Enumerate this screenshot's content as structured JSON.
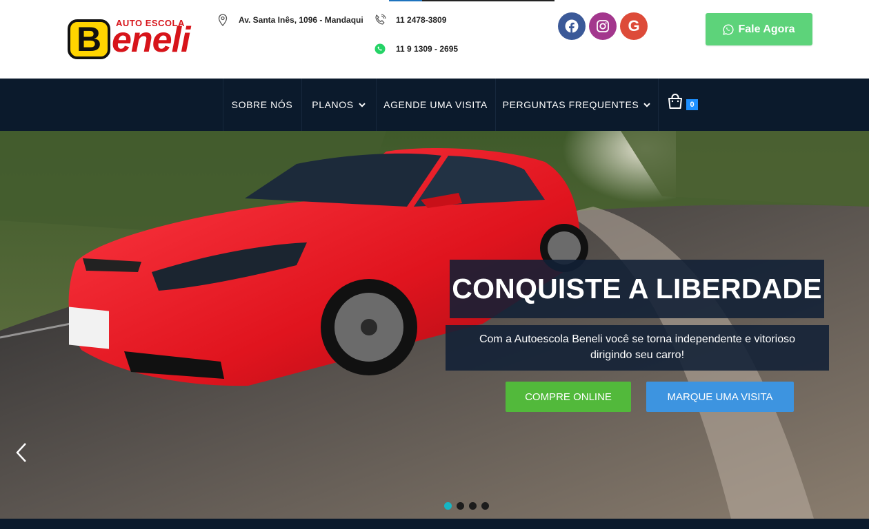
{
  "header": {
    "logo": {
      "top_text": "AUTO ESCOLA",
      "badge_letter": "B",
      "word": "eneli"
    },
    "address": "Av. Santa Inês, 1096 - Mandaqui",
    "phone": "11 2478-3809",
    "whatsapp": "11 9 1309 - 2695",
    "social": [
      "facebook-icon",
      "instagram-icon",
      "google-icon"
    ],
    "google_letter": "G",
    "cta_label": "Fale Agora"
  },
  "nav": {
    "items": [
      {
        "label": "SOBRE NÓS"
      },
      {
        "label": "PLANOS"
      },
      {
        "label": "AGENDE UMA VISITA"
      },
      {
        "label": "PERGUNTAS FREQUENTES"
      }
    ],
    "cart_count": "0"
  },
  "hero": {
    "headline": "CONQUISTE A LIBERDADE",
    "subtitle": "Com a Autoescola Beneli você se torna independente e vitorioso dirigindo seu carro!",
    "primary_button": "COMPRE ONLINE",
    "secondary_button": "MARQUE UMA VISITA",
    "slides_total": 4,
    "active_slide": 1
  },
  "colors": {
    "nav_bg": "#0b1a2c",
    "cta_green": "#5dd37a",
    "button_green": "#52b93b",
    "button_blue": "#3d94e0",
    "brand_red": "#d7141a",
    "brand_yellow": "#ffd400",
    "dot_active": "#16b6c4"
  }
}
